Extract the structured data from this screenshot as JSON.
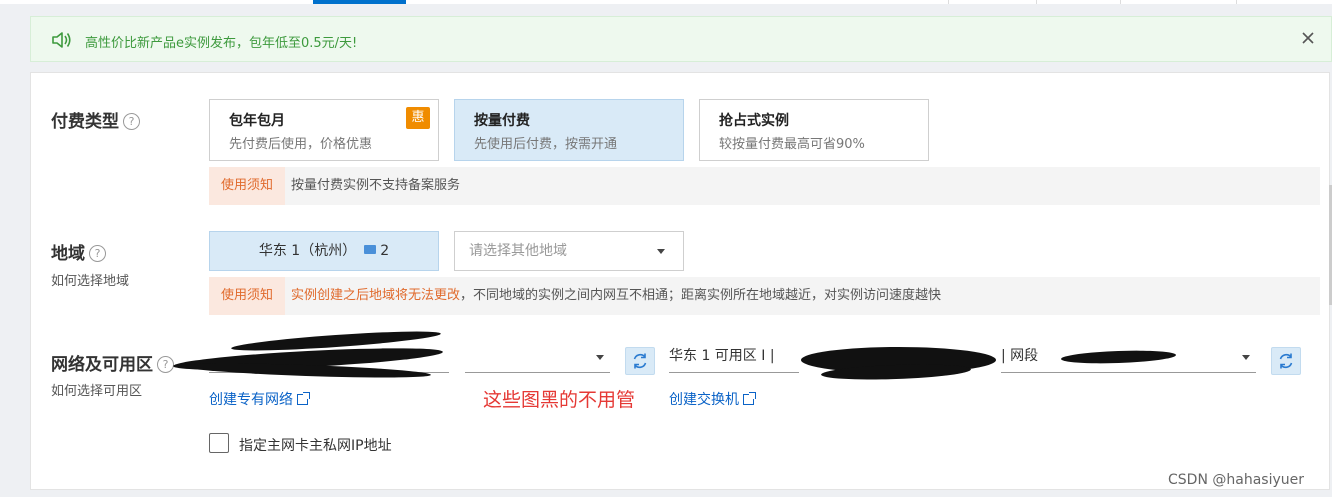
{
  "notice": {
    "text": "高性价比新产品e实例发布，包年低至0.5元/天!",
    "icon": "speaker-icon",
    "close_icon": "close-icon"
  },
  "payment": {
    "label": "付费类型",
    "help": "?",
    "options": [
      {
        "title": "包年包月",
        "desc": "先付费后使用，价格优惠",
        "badge": "惠",
        "selected": false
      },
      {
        "title": "按量付费",
        "desc": "先使用后付费，按需开通",
        "selected": true
      },
      {
        "title": "抢占式实例",
        "desc": "较按量付费最高可省90%",
        "selected": false
      }
    ],
    "tip_tag": "使用须知",
    "tip_text": "按量付费实例不支持备案服务"
  },
  "region": {
    "label": "地域",
    "help": "?",
    "sub_link": "如何选择地域",
    "selected": "华东 1（杭州）",
    "selected_count": "2",
    "other_placeholder": "请选择其他地域",
    "tip_tag": "使用须知",
    "tip_warn": "实例创建之后地域将无法更改",
    "tip_text": "，不同地域的实例之间内网互不相通；距离实例所在地域越近，对实例访问速度越快"
  },
  "network": {
    "label": "网络及可用区",
    "help": "?",
    "sub_link": "如何选择可用区",
    "zone_prefix": "华东 1 可用区 I |",
    "segment_prefix": "| 网段",
    "create_vpc": "创建专有网络",
    "create_vswitch": "创建交换机",
    "annotation": "这些图黑的不用管",
    "checkbox_label": "指定主网卡主私网IP地址"
  },
  "watermark": "CSDN @hahasiyuer",
  "colors": {
    "accent": "#0070cc",
    "selected_bg": "#d9eaf7",
    "warning": "#e06a2c",
    "notice_green": "#3d9a3d",
    "link": "#0b63c7",
    "annotation_red": "#e53935"
  }
}
